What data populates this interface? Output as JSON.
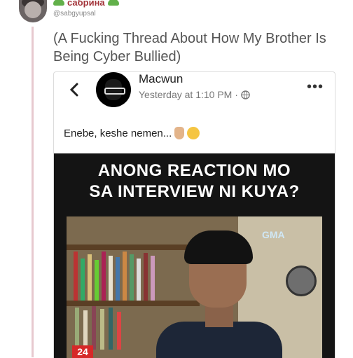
{
  "tweet": {
    "display_name": "сабрина",
    "handle": "@sabgyupsal",
    "text": "(A Fucking Thread About How My Brother Is Being Cyber Bullied)",
    "colors": {
      "thread_line": "#e7c9cf",
      "name": "#a3343a",
      "leaf": "#62b04a"
    }
  },
  "fb_post": {
    "poster_name": "Macwun",
    "timestamp": "Yesterday at 1:10 PM · ",
    "caption": "Enebe, keshe nemen...",
    "caption_emojis": [
      "victory-hand-emoji",
      "tears-of-joy-emoji"
    ],
    "icons": [
      "chevron-left-icon",
      "globe-icon",
      "more-options-icon"
    ]
  },
  "meme": {
    "title_line1": "ANONG REACTION MO",
    "title_line2": "SA INTERVIEW NI KUYA?",
    "watermark": "GMA",
    "channel_badge": "24"
  }
}
